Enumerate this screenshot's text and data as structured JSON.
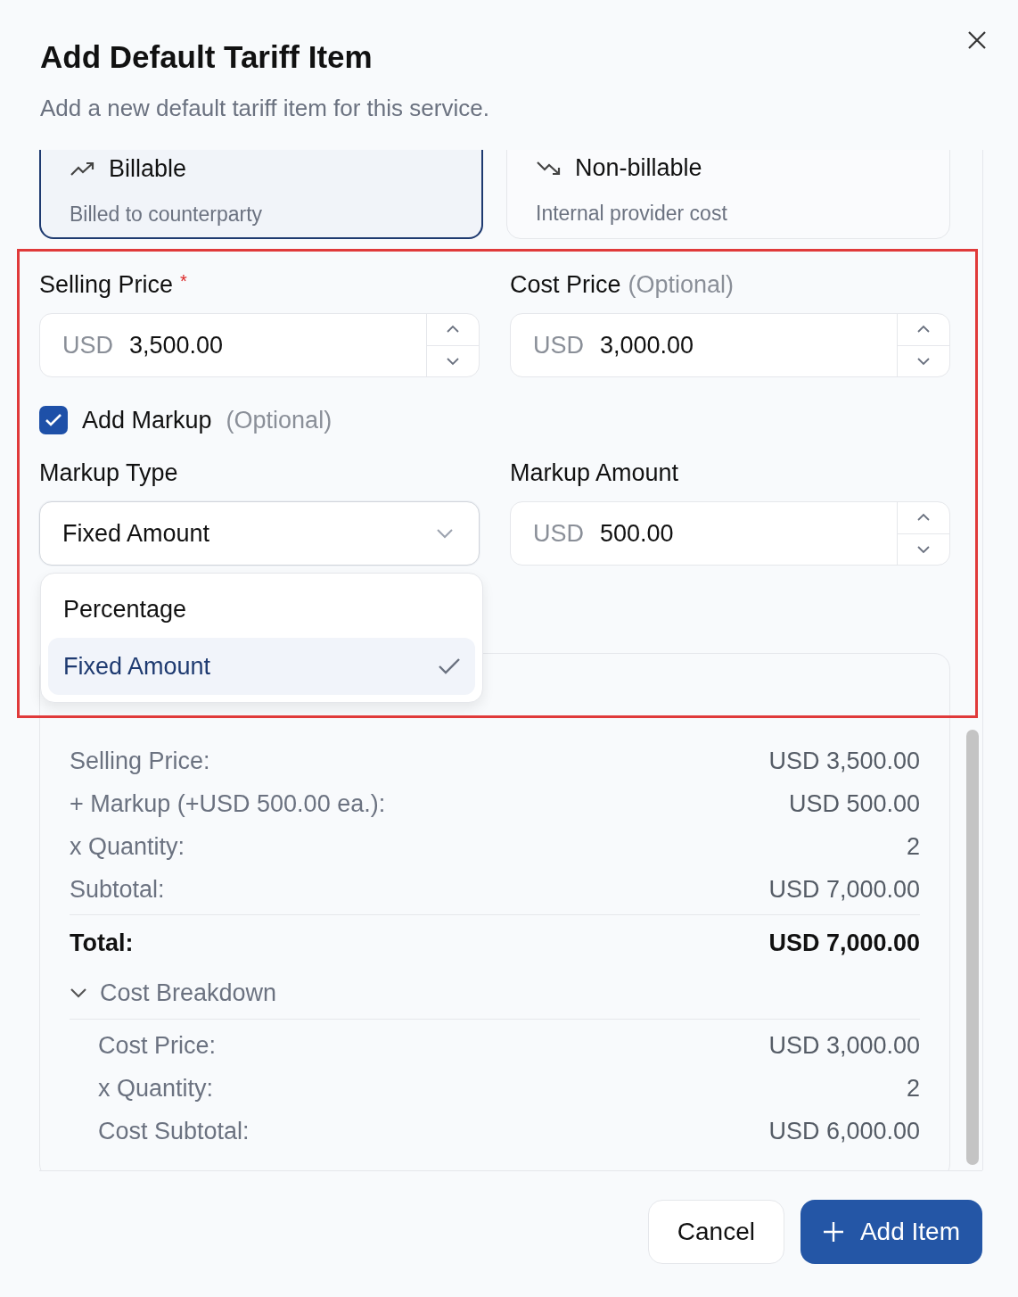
{
  "dialog": {
    "title": "Add Default Tariff Item",
    "subtitle": "Add a new default tariff item for this service."
  },
  "billing_types": [
    {
      "kind": "billable",
      "label": "Billable",
      "description": "Billed to counterparty",
      "selected": true
    },
    {
      "kind": "non_billable",
      "label": "Non-billable",
      "description": "Internal provider cost",
      "selected": false
    }
  ],
  "selling_price": {
    "label": "Selling Price",
    "required_mark": "*",
    "currency": "USD",
    "value": "3,500.00"
  },
  "cost_price": {
    "label": "Cost Price",
    "hint": "(Optional)",
    "currency": "USD",
    "value": "3,000.00"
  },
  "add_markup": {
    "label": "Add Markup",
    "hint": "(Optional)",
    "checked": true
  },
  "markup_type": {
    "label": "Markup Type",
    "value": "Fixed Amount",
    "expanded": true,
    "options": [
      {
        "label": "Percentage",
        "selected": false
      },
      {
        "label": "Fixed Amount",
        "selected": true
      }
    ]
  },
  "markup_amount": {
    "label": "Markup Amount",
    "currency": "USD",
    "value": "500.00"
  },
  "pricing_preview": {
    "rows": [
      {
        "label": "Selling Price:",
        "value": "USD 3,500.00"
      },
      {
        "label": "+ Markup (+USD 500.00 ea.):",
        "value": "USD 500.00"
      },
      {
        "label": "x Quantity:",
        "value": "2"
      },
      {
        "label": "Subtotal:",
        "value": "USD 7,000.00"
      }
    ],
    "total": {
      "label": "Total:",
      "value": "USD 7,000.00"
    },
    "cost_breakdown": {
      "label": "Cost Breakdown",
      "expanded": true,
      "rows": [
        {
          "label": "Cost Price:",
          "value": "USD 3,000.00"
        },
        {
          "label": "x Quantity:",
          "value": "2"
        },
        {
          "label": "Cost Subtotal:",
          "value": "USD 6,000.00"
        }
      ]
    }
  },
  "buttons": [
    {
      "kind": "secondary",
      "label": "Cancel"
    },
    {
      "kind": "primary",
      "label": "Add Item"
    }
  ]
}
